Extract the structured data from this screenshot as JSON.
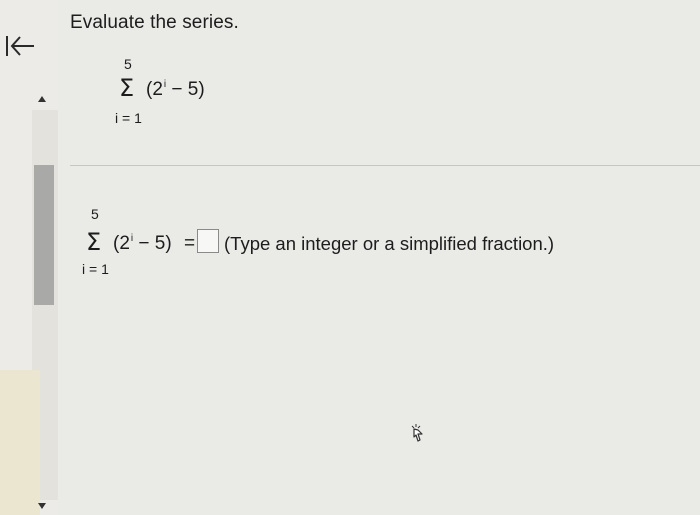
{
  "nav": {
    "back_icon": "back-arrow-icon"
  },
  "question": {
    "instruction": "Evaluate the series.",
    "series": {
      "upper_limit": "5",
      "lower_limit": "i = 1",
      "term_open": "(2",
      "exponent": "i",
      "term_close": " − 5)"
    }
  },
  "answer": {
    "series": {
      "upper_limit": "5",
      "lower_limit": "i = 1",
      "term_open": "(2",
      "exponent": "i",
      "term_close": " − 5)"
    },
    "equals": "=",
    "input_value": "",
    "hint": "(Type an integer or a simplified fraction.)"
  }
}
